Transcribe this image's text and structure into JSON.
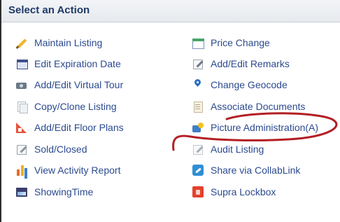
{
  "header": {
    "title": "Select an Action"
  },
  "left_column": [
    {
      "label": "Maintain Listing",
      "icon": "pencil-icon"
    },
    {
      "label": "Edit Expiration Date",
      "icon": "calendar-icon"
    },
    {
      "label": "Add/Edit Virtual Tour",
      "icon": "camera-icon"
    },
    {
      "label": "Copy/Clone Listing",
      "icon": "copy-icon"
    },
    {
      "label": "Add/Edit Floor Plans",
      "icon": "floor-plan-icon"
    },
    {
      "label": "Sold/Closed",
      "icon": "edit-icon"
    },
    {
      "label": "View Activity Report",
      "icon": "bar-chart-icon"
    },
    {
      "label": "ShowingTime",
      "icon": "showingtime-icon"
    }
  ],
  "right_column": [
    {
      "label": "Price Change",
      "icon": "price-tag-icon"
    },
    {
      "label": "Add/Edit Remarks",
      "icon": "edit-icon"
    },
    {
      "label": "Change Geocode",
      "icon": "map-pin-icon"
    },
    {
      "label": "Associate Documents",
      "icon": "document-icon"
    },
    {
      "label": "Picture Administration(A)",
      "icon": "picture-icon"
    },
    {
      "label": "Audit Listing",
      "icon": "audit-icon"
    },
    {
      "label": "Share via CollabLink",
      "icon": "share-link-icon"
    },
    {
      "label": "Supra Lockbox",
      "icon": "lockbox-icon"
    }
  ],
  "colors": {
    "link": "#2b4a8f",
    "header_text": "#1f3a67",
    "annotation": "#b21f24"
  }
}
